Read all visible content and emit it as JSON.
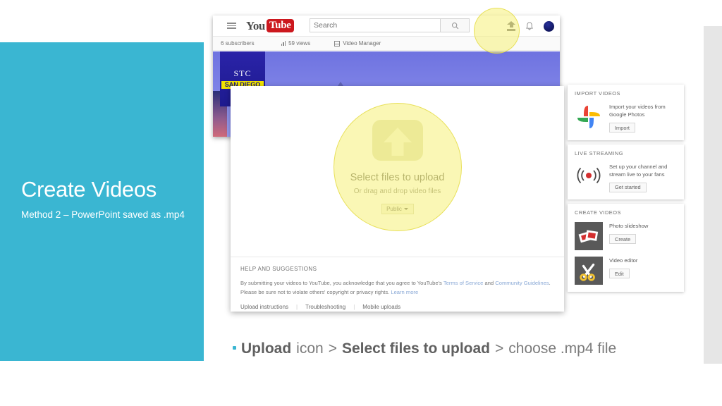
{
  "slide": {
    "title": "Create Videos",
    "subtitle": "Method 2 – PowerPoint saved as .mp4",
    "accent_color": "#3ab6d2",
    "highlight_color": "#f5f078",
    "caption": {
      "bullet": "•",
      "part1_bold": "Upload",
      "part2": "icon",
      "sep1": ">",
      "part3_bold": "Select files to upload",
      "sep2": ">",
      "part4": "choose .mp4 file"
    }
  },
  "youtube": {
    "header": {
      "menu_icon": "hamburger-icon",
      "logo_you": "You",
      "logo_tube": "Tube",
      "search_placeholder": "Search",
      "search_value": "",
      "search_icon": "search-icon",
      "upload_icon": "upload-icon",
      "notifications_icon": "bell-icon",
      "avatar": "account-avatar"
    },
    "subnav": {
      "subscribers": "6 subscribers",
      "views": "59 views",
      "views_icon": "analytics-bars-icon",
      "video_manager": "Video Manager",
      "video_manager_icon": "grid-icon"
    },
    "banner": {
      "badge_line1": "STC",
      "badge_line2": "SAN DIEGO"
    },
    "upload_dialog": {
      "upload_icon": "upload-arrow-icon",
      "title": "Select files to upload",
      "subtitle": "Or drag and drop video files",
      "privacy_value": "Public",
      "privacy_caret": "chevron-down-icon",
      "help_title": "HELP AND SUGGESTIONS",
      "help_line1_a": "By submitting your videos to YouTube, you acknowledge that you agree to YouTube's ",
      "help_link_tos": "Terms of Service",
      "help_line1_b": " and ",
      "help_link_guidelines": "Community Guidelines",
      "help_line1_c": ".",
      "help_line2_a": "Please be sure not to violate others' copyright or privacy rights. ",
      "help_link_learn": "Learn more",
      "link_upload_instructions": "Upload instructions",
      "link_troubleshooting": "Troubleshooting",
      "link_mobile_uploads": "Mobile uploads",
      "separator": "|"
    },
    "sidebar": {
      "import_videos": {
        "heading": "IMPORT VIDEOS",
        "icon": "google-photos-icon",
        "description": "Import your videos from Google Photos",
        "button": "Import"
      },
      "live_streaming": {
        "heading": "LIVE STREAMING",
        "icon": "live-broadcast-icon",
        "description": "Set up your channel and stream live to your fans",
        "button": "Get started"
      },
      "create_videos": {
        "heading": "CREATE VIDEOS",
        "items": [
          {
            "icon": "photo-slideshow-icon",
            "label": "Photo slideshow",
            "button": "Create"
          },
          {
            "icon": "video-editor-scissors-icon",
            "label": "Video editor",
            "button": "Edit"
          }
        ]
      }
    }
  }
}
